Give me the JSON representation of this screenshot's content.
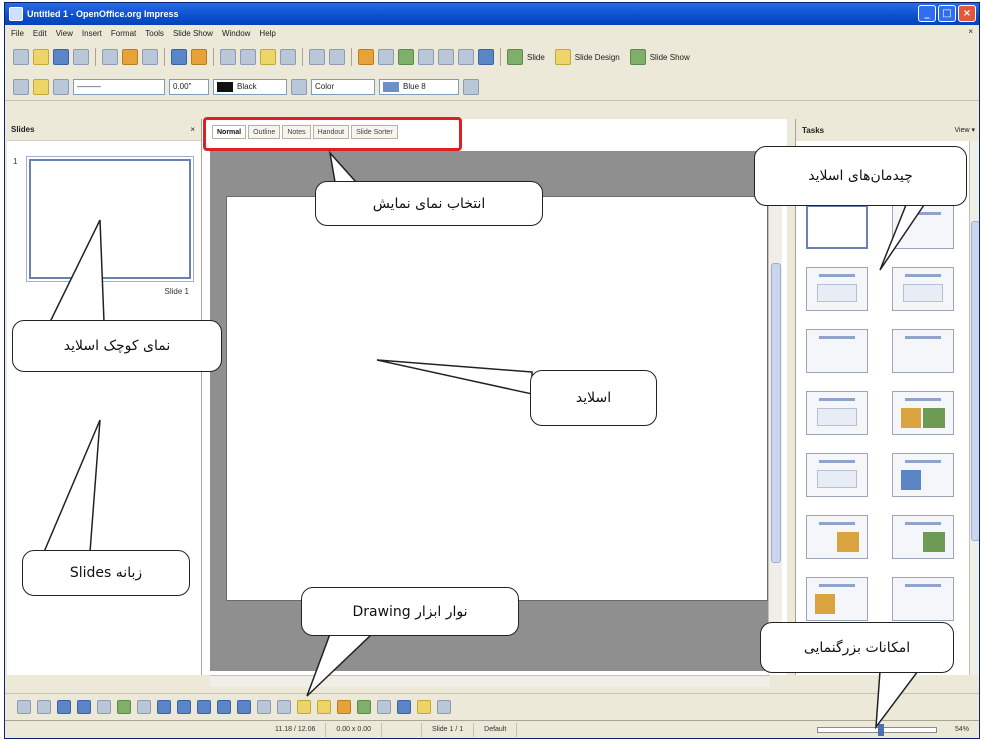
{
  "window": {
    "title": "Untitled 1 - OpenOffice.org Impress",
    "min": "_",
    "max": "□",
    "close": "×"
  },
  "menu": [
    "File",
    "Edit",
    "View",
    "Insert",
    "Format",
    "Tools",
    "Slide Show",
    "Window",
    "Help"
  ],
  "toolbar": {
    "slide_label": "Slide",
    "slide_design_label": "Slide Design",
    "slide_show_label": "Slide Show",
    "line_width": "0.00\"",
    "line_color": "Black",
    "fill_mode": "Color",
    "fill_color": "Blue 8"
  },
  "slides_pane": {
    "title": "Slides",
    "thumb_number": "1",
    "thumb_label": "Slide 1"
  },
  "view_tabs": [
    "Normal",
    "Outline",
    "Notes",
    "Handout",
    "Slide Sorter"
  ],
  "tasks_pane": {
    "title": "Tasks",
    "view_label": "View ▾"
  },
  "status": {
    "position": "11.18 / 12.06",
    "size": "0.00 x 0.00",
    "slide": "Slide 1 / 1",
    "layout": "Default",
    "zoom": "54%"
  },
  "callouts": {
    "view_select": "انتخاب نمای نمایش",
    "layouts": "چیدمان‌های اسلاید",
    "thumb_view": "نمای کوچک اسلاید",
    "slide": "اسلاید",
    "slides_tab": "زبانه Slides",
    "drawing_bar": "نوار ابزار Drawing",
    "zoom": "امکانات بزرگنمایی"
  },
  "colors": {
    "highlight": "#e02020",
    "titlebar": "#0a4fd1",
    "canvas": "#8f8f8f"
  }
}
